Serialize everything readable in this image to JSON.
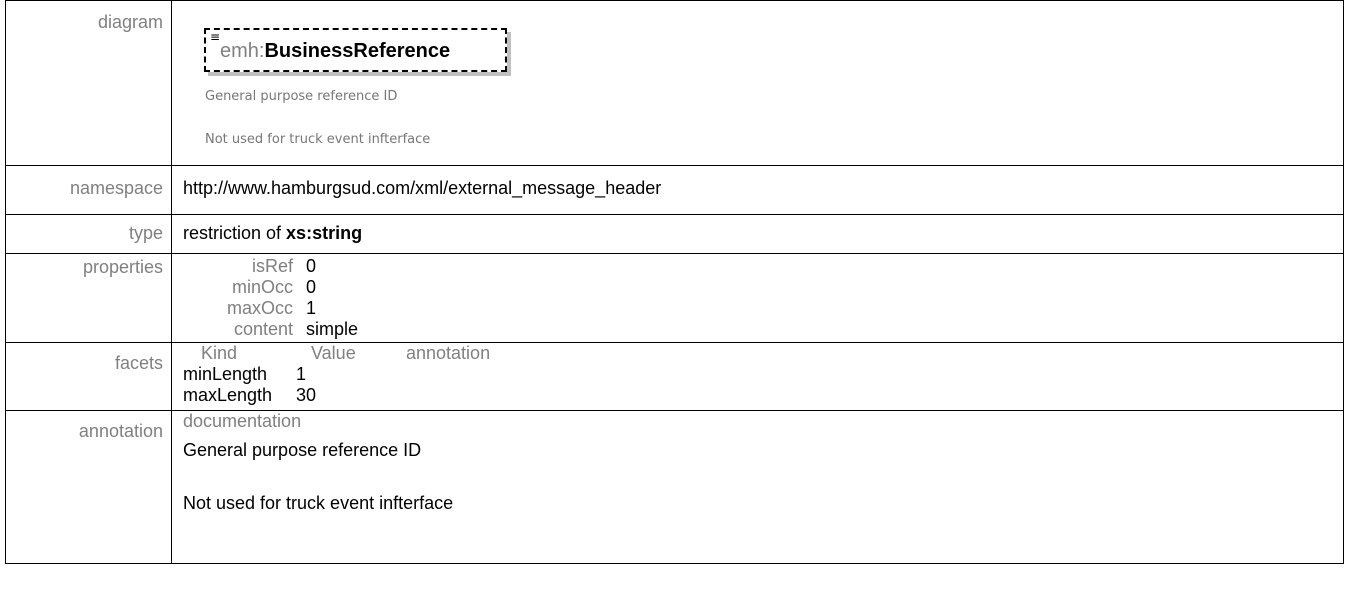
{
  "labels": {
    "diagram": "diagram",
    "namespace": "namespace",
    "type": "type",
    "properties": "properties",
    "facets": "facets",
    "annotation": "annotation"
  },
  "diagram": {
    "prefix": "emh:",
    "name": "BusinessReference",
    "doc_line1": "General purpose reference ID",
    "doc_line2": "Not used for truck event infterface"
  },
  "namespace": "http://www.hamburgsud.com/xml/external_message_header",
  "type": {
    "text": "restriction of ",
    "base": "xs:string"
  },
  "properties": [
    {
      "key": "isRef",
      "value": "0"
    },
    {
      "key": "minOcc",
      "value": "0"
    },
    {
      "key": "maxOcc",
      "value": "1"
    },
    {
      "key": "content",
      "value": "simple"
    }
  ],
  "facets": {
    "headers": [
      "Kind",
      "Value",
      "annotation"
    ],
    "rows": [
      {
        "kind": "minLength",
        "value": "1"
      },
      {
        "kind": "maxLength",
        "value": "30"
      }
    ]
  },
  "annotation": {
    "heading": "documentation",
    "line1": "General purpose reference ID",
    "line2": "Not used for truck event infterface"
  }
}
